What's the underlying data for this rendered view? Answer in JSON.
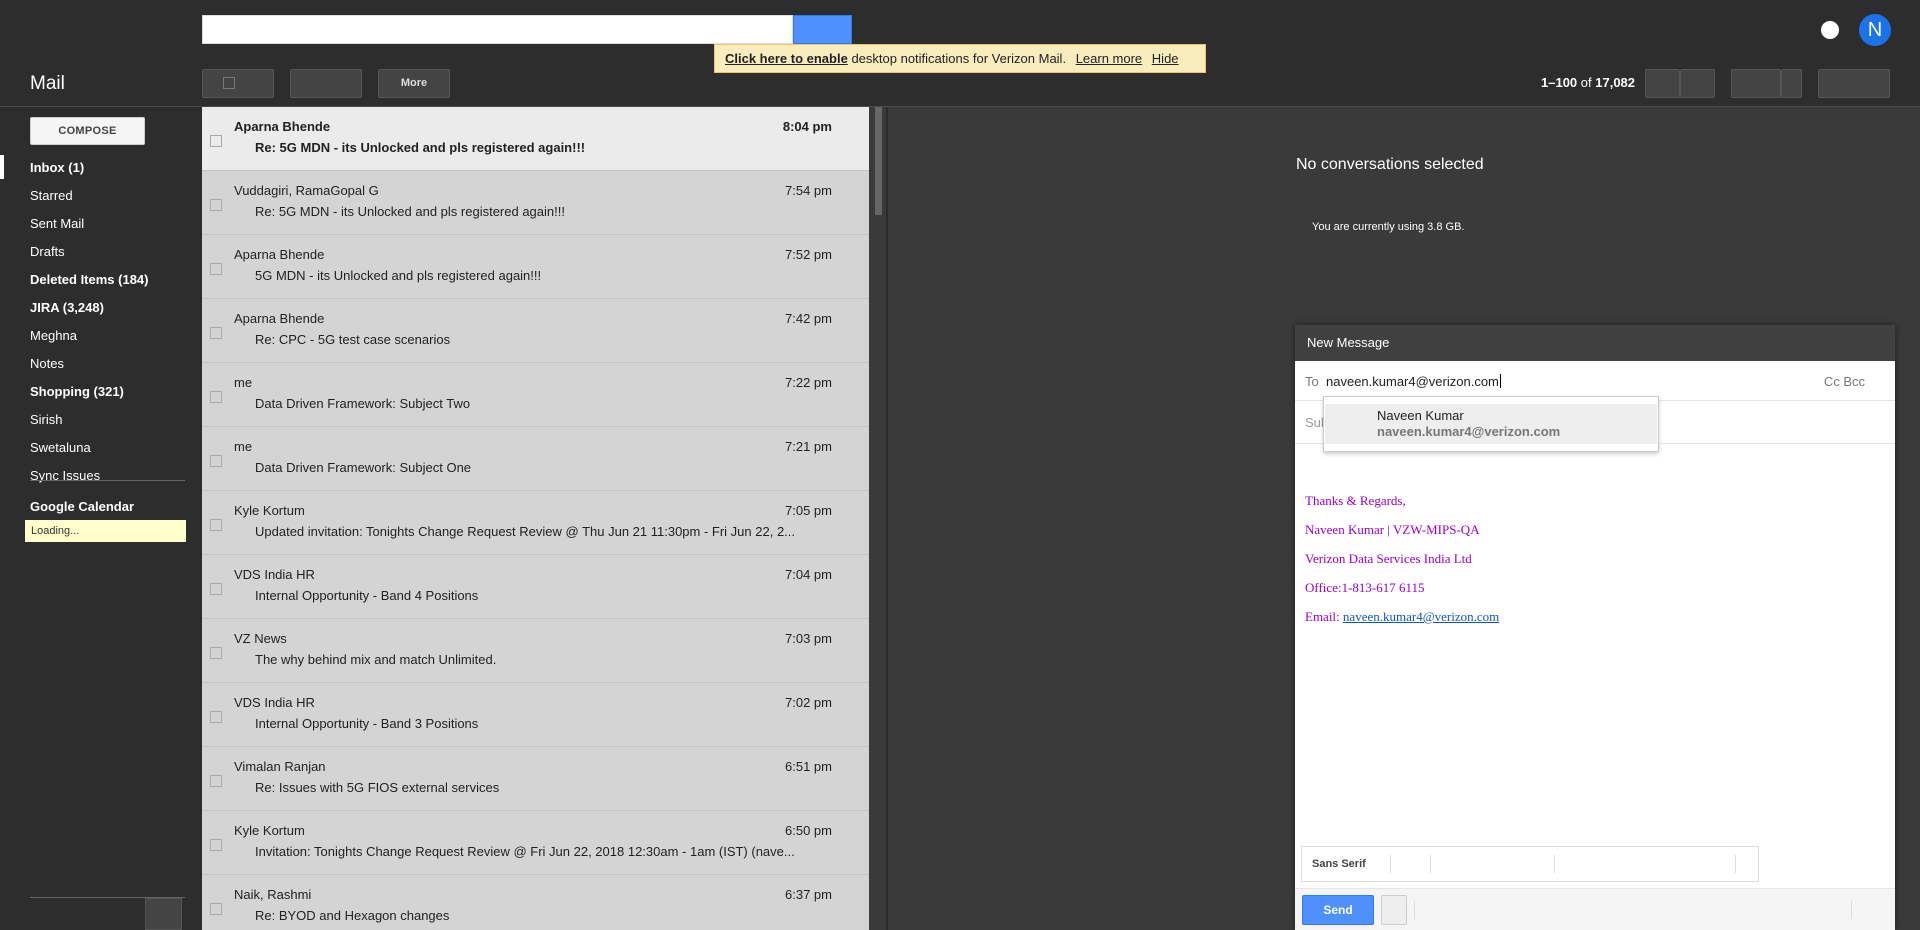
{
  "header": {
    "search_placeholder": "",
    "avatar_letter": "N"
  },
  "notification": {
    "link_enable": "Click here to enable",
    "message": "desktop notifications for Verizon Mail.",
    "learn_more": "Learn more",
    "hide": "Hide"
  },
  "toolbar": {
    "title": "Mail",
    "more_label": "More",
    "page_range": "1–100",
    "page_of": "of",
    "page_total": "17,082"
  },
  "sidebar": {
    "compose_label": "COMPOSE",
    "items": [
      {
        "label": "Inbox (1)",
        "bold": true
      },
      {
        "label": "Starred",
        "bold": false
      },
      {
        "label": "Sent Mail",
        "bold": false
      },
      {
        "label": "Drafts",
        "bold": false
      },
      {
        "label": "Deleted Items (184)",
        "bold": true
      },
      {
        "label": "JIRA (3,248)",
        "bold": true
      },
      {
        "label": "Meghna",
        "bold": false
      },
      {
        "label": "Notes",
        "bold": false
      },
      {
        "label": "Shopping (321)",
        "bold": true
      },
      {
        "label": "Sirish",
        "bold": false
      },
      {
        "label": "Swetaluna",
        "bold": false
      },
      {
        "label": "Sync Issues",
        "bold": false
      }
    ],
    "calendar_title": "Google Calendar",
    "calendar_loading": "Loading..."
  },
  "messages": [
    {
      "sender": "Aparna Bhende",
      "subject": "Re: 5G MDN - its Unlocked and pls registered again!!!",
      "time": "8:04 pm",
      "unread": true
    },
    {
      "sender": "Vuddagiri, RamaGopal G",
      "subject": "Re: 5G MDN - its Unlocked and pls registered again!!!",
      "time": "7:54 pm",
      "unread": false
    },
    {
      "sender": "Aparna Bhende",
      "subject": "5G MDN - its Unlocked and pls registered again!!!",
      "time": "7:52 pm",
      "unread": false
    },
    {
      "sender": "Aparna Bhende",
      "subject": "Re: CPC - 5G test case scenarios",
      "time": "7:42 pm",
      "unread": false
    },
    {
      "sender": "me",
      "subject": "Data Driven Framework: Subject Two",
      "time": "7:22 pm",
      "unread": false
    },
    {
      "sender": "me",
      "subject": "Data Driven Framework: Subject One",
      "time": "7:21 pm",
      "unread": false
    },
    {
      "sender": "Kyle Kortum",
      "subject": "Updated invitation: Tonights Change Request Review @ Thu Jun 21 11:30pm - Fri Jun 22, 2...",
      "time": "7:05 pm",
      "unread": false
    },
    {
      "sender": "VDS India HR",
      "subject": "Internal Opportunity - Band 4 Positions",
      "time": "7:04 pm",
      "unread": false
    },
    {
      "sender": "VZ News",
      "subject": "The why behind mix and match Unlimited.",
      "time": "7:03 pm",
      "unread": false
    },
    {
      "sender": "VDS India HR",
      "subject": "Internal Opportunity - Band 3 Positions",
      "time": "7:02 pm",
      "unread": false
    },
    {
      "sender": "Vimalan Ranjan",
      "subject": "Re: Issues with 5G FIOS external services",
      "time": "6:51 pm",
      "unread": false
    },
    {
      "sender": "Kyle Kortum",
      "subject": "Invitation: Tonights Change Request Review @ Fri Jun 22, 2018 12:30am - 1am (IST) (nave...",
      "time": "6:50 pm",
      "unread": false
    },
    {
      "sender": "Naik, Rashmi",
      "subject": "Re: BYOD and Hexagon changes",
      "time": "6:37 pm",
      "unread": false
    }
  ],
  "preview": {
    "no_conversations": "No conversations selected",
    "storage": "You are currently using 3.8 GB."
  },
  "compose": {
    "title": "New Message",
    "to_label": "To",
    "to_value": "naveen.kumar4@verizon.com",
    "cc_bcc": "Cc  Bcc",
    "subject_label": "Sub",
    "suggestion_name": "Naveen Kumar",
    "suggestion_email": "naveen.kumar4@verizon.com",
    "signature": {
      "line1": "Thanks & Regards,",
      "line2": " Naveen Kumar | VZW-MIPS-QA",
      "line3": "Verizon Data Services India Ltd",
      "line4": "Office:1-813-617 6115",
      "email_prefix": "Email: ",
      "email_link": "naveen.kumar4@verizon.com"
    },
    "font_label": "Sans Serif",
    "send_label": "Send"
  },
  "colors": {
    "accent": "#4d90fe",
    "signature": "#9900cc",
    "link": "#1155cc"
  }
}
